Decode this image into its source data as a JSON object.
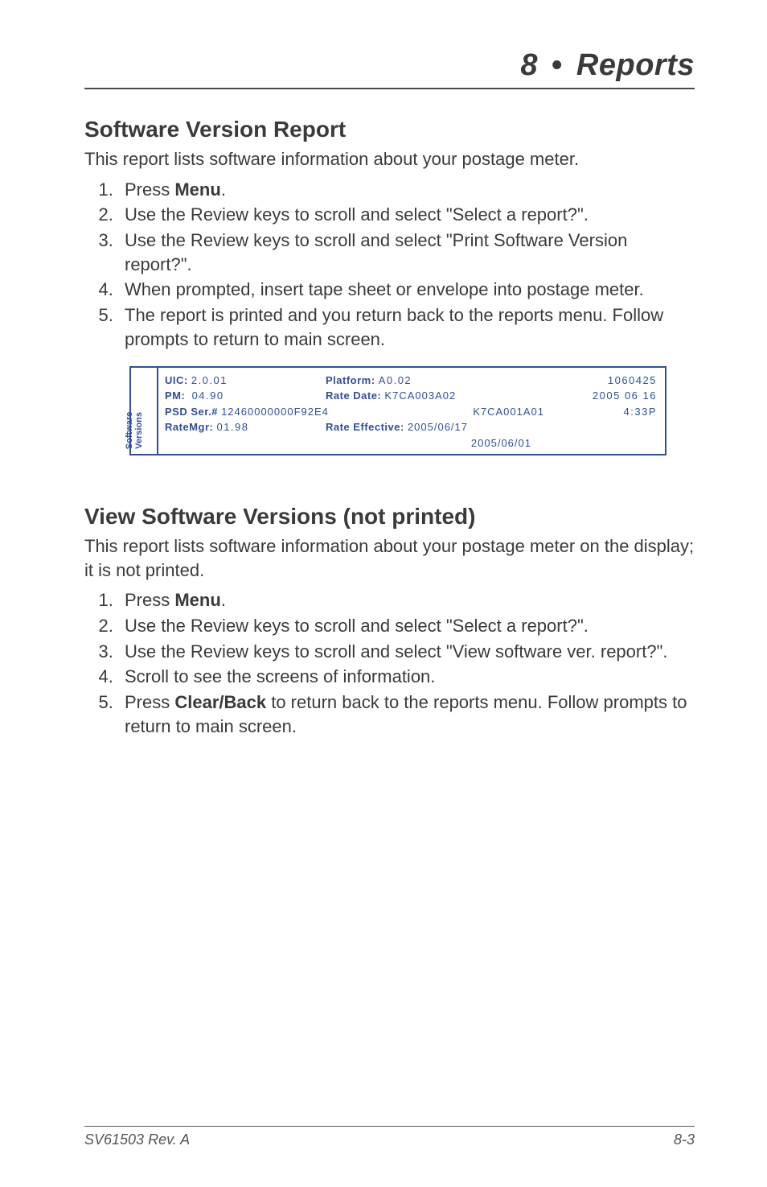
{
  "header": {
    "chapter_num": "8",
    "chapter_title": "Reports"
  },
  "section1": {
    "title": "Software Version Report",
    "intro": "This report lists software information about your postage meter.",
    "steps": [
      {
        "pre": "Press ",
        "bold": "Menu",
        "post": "."
      },
      {
        "text": "Use the Review keys to scroll and select \"Select a report?\"."
      },
      {
        "text": "Use the Review keys to scroll and select \"Print Software Version report?\"."
      },
      {
        "text": "When prompted, insert tape sheet or envelope into postage meter."
      },
      {
        "text": "The report is printed and you return back to the reports menu. Follow prompts to return to main screen."
      }
    ]
  },
  "report": {
    "side_line1": "Software",
    "side_line2": "Versions",
    "uic_lbl": "UIC:",
    "uic_val": "2.0.01",
    "platform_lbl": "Platform:",
    "platform_val": "A0.02",
    "topright1": "1060425",
    "pm_lbl": "PM:",
    "pm_val": "04.90",
    "ratedate_lbl": "Rate Date:",
    "ratedate_val": "K7CA003A02",
    "topright2": "2005 06 16",
    "psd_lbl": "PSD Ser.#",
    "psd_val": "12460000000F92E4",
    "k7_val": "K7CA001A01",
    "topright3": "4:33P",
    "ratemgr_lbl": "RateMgr:",
    "ratemgr_val": "01.98",
    "rateeff_lbl": "Rate Effective:",
    "rateeff_val": "2005/06/17",
    "rateeff_val2": "2005/06/01"
  },
  "section2": {
    "title": "View Software Versions (not printed)",
    "intro": "This report lists software information about your postage meter on the display; it is not printed.",
    "steps": [
      {
        "pre": "Press ",
        "bold": "Menu",
        "post": "."
      },
      {
        "text": "Use the Review keys to scroll and select \"Select a report?\"."
      },
      {
        "text": "Use the Review keys to scroll and select \"View software ver. report?\"."
      },
      {
        "text": "Scroll to see the screens of information."
      },
      {
        "pre": "Press ",
        "bold": "Clear/Back",
        "post": " to return back to the reports menu. Follow prompts to return to main screen."
      }
    ]
  },
  "footer": {
    "left": "SV61503 Rev. A",
    "right": "8-3"
  }
}
